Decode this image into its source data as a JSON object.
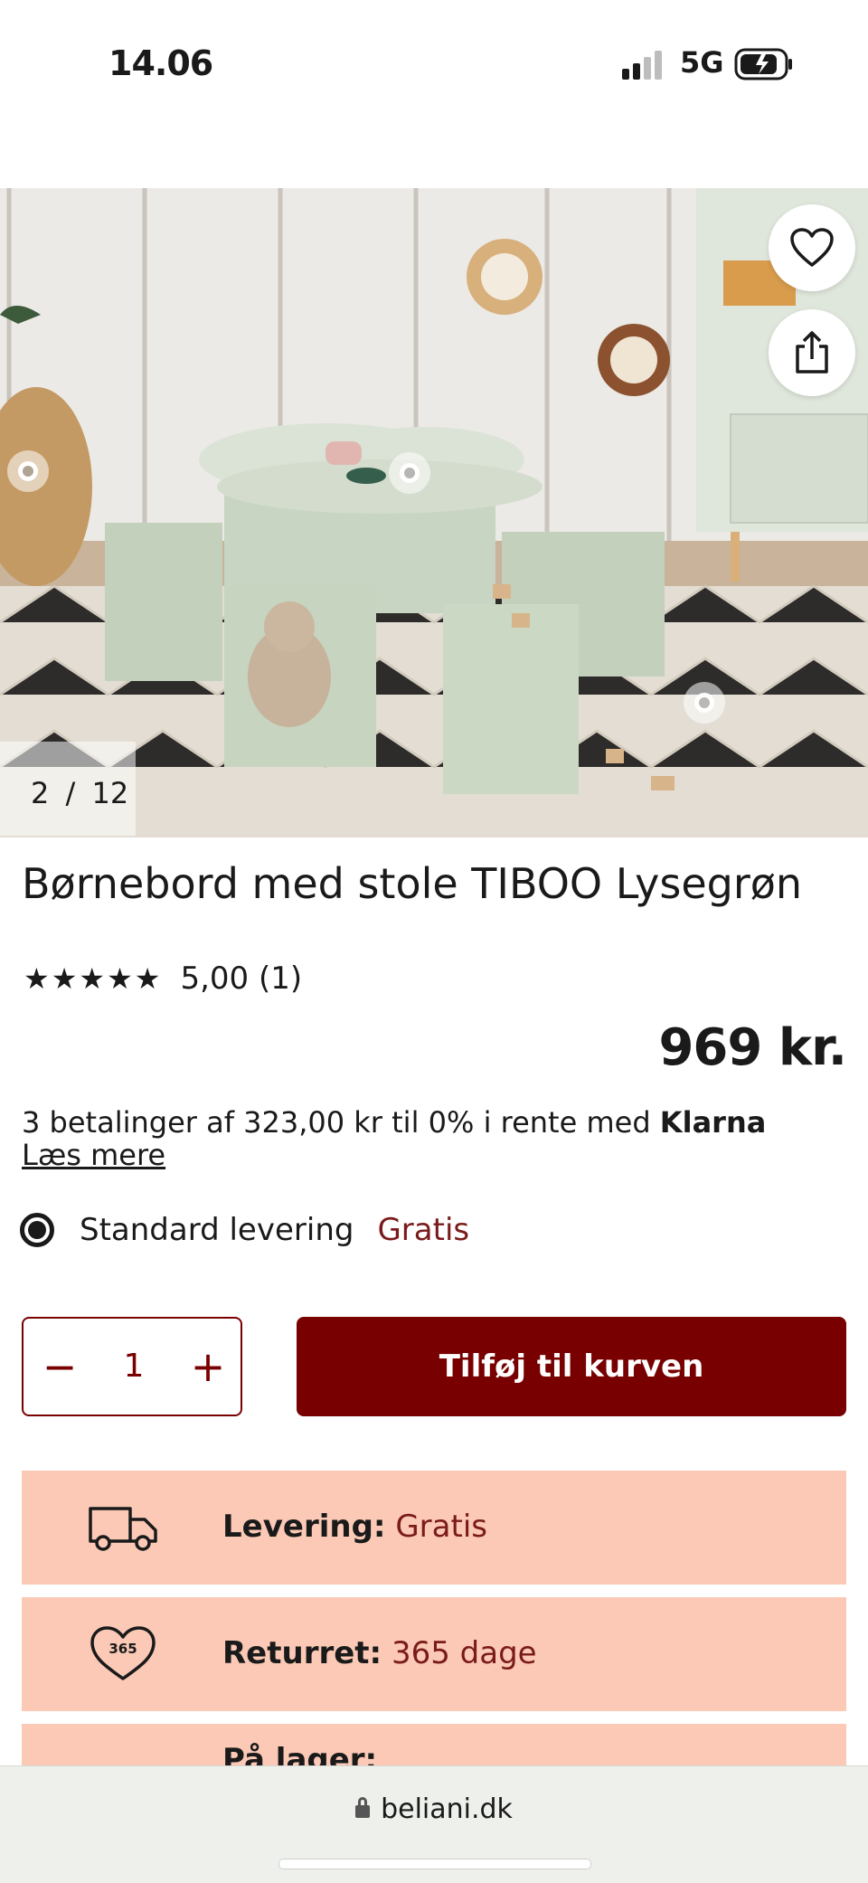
{
  "status": {
    "time": "14.06",
    "network": "5G"
  },
  "gallery": {
    "counter_current": "2",
    "counter_sep": "/",
    "counter_total": "12"
  },
  "product": {
    "title": "Børnebord med stole TIBOO Lysegrøn",
    "stars": "★★★★★",
    "rating": "5,00 (1)",
    "price": "969 kr.",
    "installment_text": "3 betalinger af 323,00 kr til 0% i rente med ",
    "installment_brand": "Klarna",
    "read_more": "Læs mere"
  },
  "delivery": {
    "label": "Standard levering",
    "price": "Gratis"
  },
  "cart": {
    "quantity": "1",
    "minus": "−",
    "plus": "+",
    "add_label": "Tilføj til kurven"
  },
  "info": [
    {
      "label": "Levering:",
      "value": "Gratis",
      "icon": "truck-icon"
    },
    {
      "label": "Returret:",
      "value": "365 dage",
      "icon": "return-365-icon",
      "badge": "365"
    },
    {
      "label": "På lager:",
      "value": "",
      "icon": "stock-icon"
    }
  ],
  "browser": {
    "url": "beliani.dk"
  },
  "colors": {
    "accent": "#780000",
    "info_bg": "#fbc9b6",
    "price_text": "#7a1a1a"
  }
}
